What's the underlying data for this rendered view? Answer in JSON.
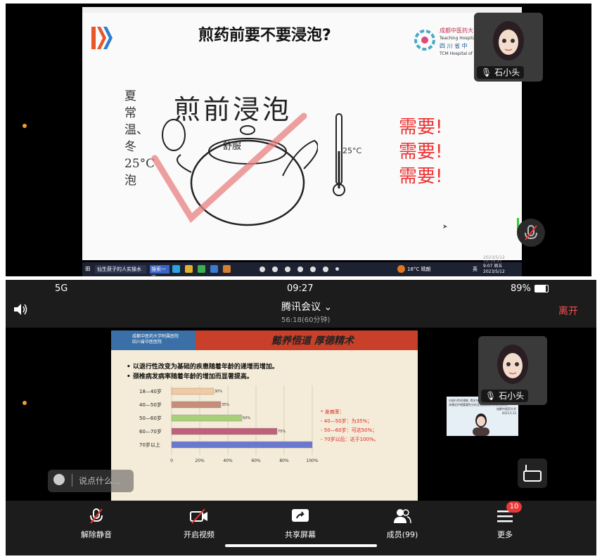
{
  "top": {
    "slide": {
      "title": "煎药前要不要浸泡?",
      "logo_lines": [
        "成都中医药大",
        "Teaching Hospital of Ch",
        "四 川 省 中",
        "TCM Hospital of"
      ],
      "hand_title": "煎前浸泡",
      "vertical_text": "夏常温、冬25°C泡",
      "pot_label": "舒服",
      "temp_label": "25°C",
      "need": [
        "需要!",
        "需要!",
        "需要!"
      ],
      "footer": "2023/5/12 10:23:41"
    },
    "taskbar": {
      "search_label": "搜索一下",
      "window_label": "仙生获子的人实操水",
      "weather": "18°C 晴朗",
      "time": "9:07 周五",
      "date": "2023/5/12",
      "ime": "英"
    },
    "participant": {
      "name": "石小头"
    }
  },
  "bottom": {
    "status": {
      "network": "5G",
      "time": "09:27",
      "battery": "89%"
    },
    "meeting": {
      "title": "腾讯会议",
      "duration": "56:18(60分钟)",
      "leave": "离开"
    },
    "slide": {
      "motto": "懿养悟道 厚德精术",
      "header_logo": [
        "成都中医药大学附属医院",
        "四川省中医医院"
      ],
      "bullets": [
        "• 以退行性改变为基础的疾患随着年龄的递增而增加。",
        "• 颈椎病发病率随着年龄的增加而显著提高。"
      ],
      "note_title": "* 发病率：",
      "notes": [
        "- 40—50岁：为35%；",
        "- 50—60岁：可达50%；",
        "- 70岁以后：达于100%。"
      ],
      "inset_lines": [
        "对退行性的颈椎, 骨关节病与关节炎。护理等相",
        "关循证护理重要性分析及其指标体系的优化研究",
        "成都中医药大学",
        "2023.5.12"
      ]
    },
    "chart_data": {
      "type": "bar",
      "orientation": "horizontal",
      "categories": [
        "18—40岁",
        "40—50岁",
        "50—60岁",
        "60—70岁",
        "70岁以上"
      ],
      "values": [
        30,
        35,
        50,
        75,
        100
      ],
      "value_labels": [
        "30%",
        "35%",
        "50%",
        "75%",
        ""
      ],
      "x_ticks": [
        "0",
        "20%",
        "40%",
        "60%",
        "80%",
        "100%"
      ],
      "xlim": [
        0,
        100
      ],
      "colors": [
        "#f2c9a0",
        "#c68d7a",
        "#a8d07a",
        "#c0607a",
        "#6a78d0"
      ]
    },
    "chat_placeholder": "说点什么...",
    "participant": {
      "name": "石小头"
    },
    "toolbar": {
      "mute": "解除静音",
      "video": "开启视频",
      "share": "共享屏幕",
      "members": "成员(99)",
      "more": "更多",
      "more_badge": "10"
    }
  }
}
